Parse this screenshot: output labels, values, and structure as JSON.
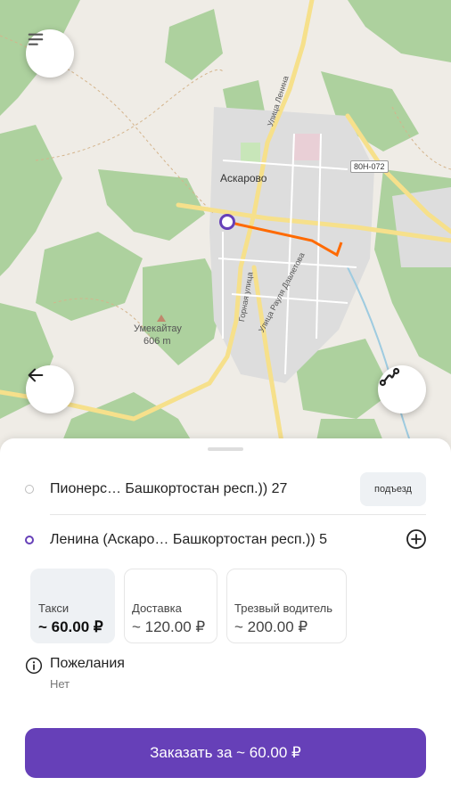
{
  "map": {
    "town_label": "Аскарово",
    "mountain_label": "Умекайтау",
    "mountain_elevation": "606 m",
    "road_badge": "80Н-072",
    "street_labels": [
      "Улица Ленина",
      "Горная улица",
      "Улица Рауля Давлетова"
    ]
  },
  "addresses": {
    "from": "Пионерс…  Башкортостан респ.)) 27",
    "to": "Ленина (Аскаро…  Башкортостан респ.)) 5",
    "entrance_label": "подъезд"
  },
  "tariffs": [
    {
      "name": "Такси",
      "price": "~ 60.00 ₽",
      "selected": true
    },
    {
      "name": "Доставка",
      "price": "~ 120.00 ₽",
      "selected": false
    },
    {
      "name": "Трезвый водитель",
      "price": "~ 200.00 ₽",
      "selected": false
    }
  ],
  "wishes": {
    "title": "Пожелания",
    "value": "Нет"
  },
  "order_button": "Заказать за ~ 60.00 ₽",
  "colors": {
    "accent": "#6640b8",
    "route": "#ff6a00",
    "forest": "#add19e",
    "roads": "#f6e08b"
  },
  "icons": [
    "menu-icon",
    "arrow-left-icon",
    "route-icon",
    "plus-circle-icon",
    "info-icon"
  ]
}
